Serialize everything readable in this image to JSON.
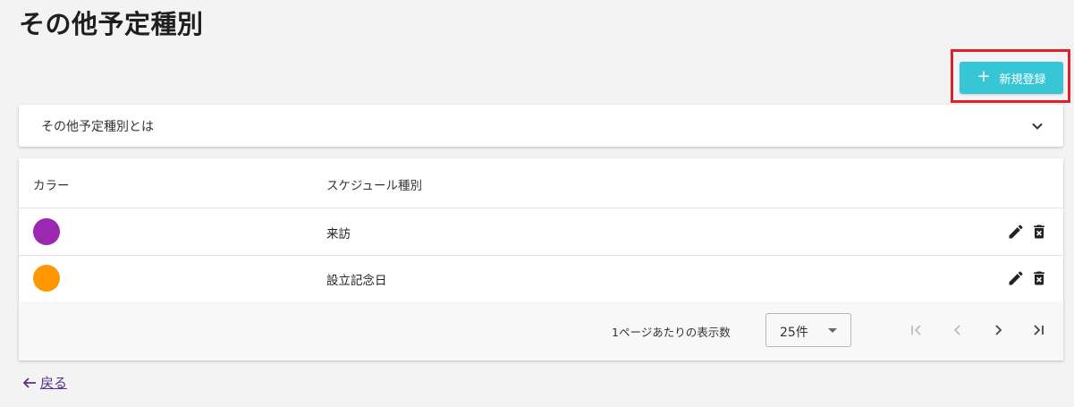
{
  "page": {
    "title": "その他予定種別"
  },
  "toolbar": {
    "new_label": "新規登録",
    "plus_symbol": "+"
  },
  "info_panel": {
    "label": "その他予定種別とは",
    "icon": "chevron-down-icon"
  },
  "table": {
    "headers": {
      "color": "カラー",
      "type": "スケジュール種別"
    },
    "rows": [
      {
        "color": "#9c27b0",
        "name": "来訪"
      },
      {
        "color": "#ff9800",
        "name": "設立記念日"
      }
    ]
  },
  "pagination": {
    "per_page_label": "1ページあたりの表示数",
    "per_page_value": "25件",
    "icons": [
      "first-page-icon",
      "prev-page-icon",
      "next-page-icon",
      "last-page-icon"
    ]
  },
  "back": {
    "label": "戻る"
  },
  "colors": {
    "accent": "#37c6d6",
    "highlight": "#e0202a",
    "link": "#5a2f8c"
  }
}
